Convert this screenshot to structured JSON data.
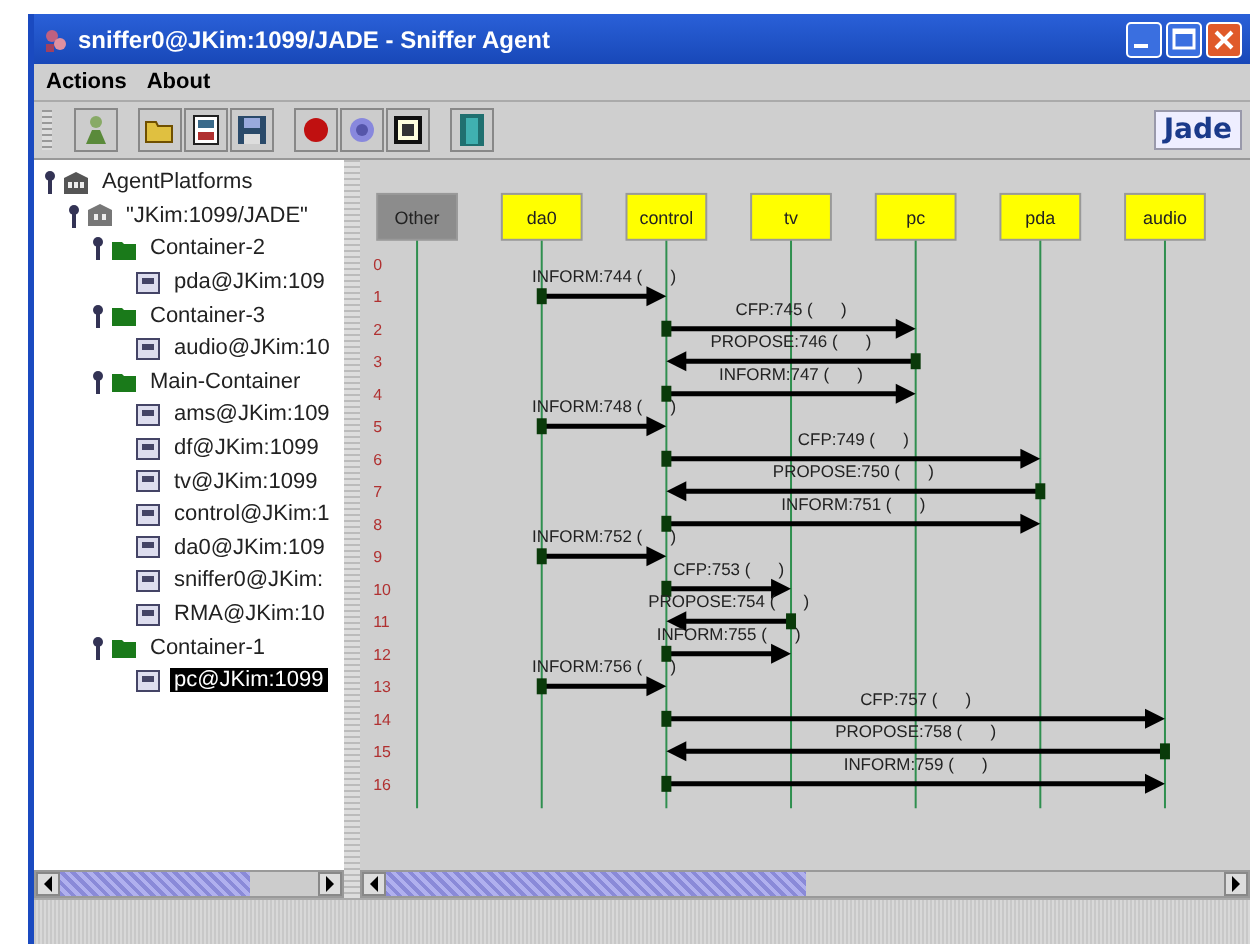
{
  "window": {
    "title": "sniffer0@JKim:1099/JADE - Sniffer Agent"
  },
  "menu": [
    {
      "label": "Actions"
    },
    {
      "label": "About"
    }
  ],
  "toolbar": {
    "logo": "Jade"
  },
  "tree": [
    {
      "label": "AgentPlatforms",
      "kind": "root",
      "expanded": true,
      "selected": false,
      "children": [
        {
          "label": "\"JKim:1099/JADE\"",
          "kind": "platform",
          "expanded": true,
          "selected": false,
          "children": [
            {
              "label": "Container-2",
              "kind": "container",
              "expanded": true,
              "selected": false,
              "children": [
                {
                  "label": "pda@JKim:109",
                  "kind": "agent",
                  "selected": false
                }
              ]
            },
            {
              "label": "Container-3",
              "kind": "container",
              "expanded": true,
              "selected": false,
              "children": [
                {
                  "label": "audio@JKim:10",
                  "kind": "agent",
                  "selected": false
                }
              ]
            },
            {
              "label": "Main-Container",
              "kind": "container",
              "expanded": true,
              "selected": false,
              "children": [
                {
                  "label": "ams@JKim:109",
                  "kind": "agent",
                  "selected": false
                },
                {
                  "label": "df@JKim:1099",
                  "kind": "agent",
                  "selected": false
                },
                {
                  "label": "tv@JKim:1099",
                  "kind": "agent",
                  "selected": false
                },
                {
                  "label": "control@JKim:1",
                  "kind": "agent",
                  "selected": false
                },
                {
                  "label": "da0@JKim:109",
                  "kind": "agent",
                  "selected": false
                },
                {
                  "label": "sniffer0@JKim:",
                  "kind": "agent",
                  "selected": false
                },
                {
                  "label": "RMA@JKim:10",
                  "kind": "agent",
                  "selected": false
                }
              ]
            },
            {
              "label": "Container-1",
              "kind": "container",
              "expanded": true,
              "selected": false,
              "children": [
                {
                  "label": "pc@JKim:1099",
                  "kind": "agent",
                  "selected": true
                }
              ]
            }
          ]
        }
      ]
    }
  ],
  "sniffer": {
    "agents": [
      {
        "name": "Other",
        "color": "#8c8c8c"
      },
      {
        "name": "da0",
        "color": "#ffff00"
      },
      {
        "name": "control",
        "color": "#ffff00"
      },
      {
        "name": "tv",
        "color": "#ffff00"
      },
      {
        "name": "pc",
        "color": "#ffff00"
      },
      {
        "name": "pda",
        "color": "#ffff00"
      },
      {
        "name": "audio",
        "color": "#ffff00"
      }
    ],
    "rows": [
      {
        "number": "0"
      },
      {
        "number": "1",
        "message": {
          "label": "INFORM:744 (      )",
          "ends": [
            {
              "kind": "none"
            },
            {
              "kind": "sender"
            },
            {
              "kind": "receiver"
            }
          ]
        }
      },
      {
        "number": "2",
        "message": {
          "label": "CFP:745 (      )",
          "ends": [
            {
              "kind": "none"
            },
            {
              "kind": "none"
            },
            {
              "kind": "sender"
            },
            {
              "kind": "none"
            },
            {
              "kind": "receiver"
            }
          ]
        }
      },
      {
        "number": "3",
        "message": {
          "label": "PROPOSE:746 (      )",
          "ends": [
            {
              "kind": "none"
            },
            {
              "kind": "none"
            },
            {
              "kind": "receiver"
            },
            {
              "kind": "none"
            },
            {
              "kind": "sender"
            }
          ]
        }
      },
      {
        "number": "4",
        "message": {
          "label": "INFORM:747 (      )",
          "ends": [
            {
              "kind": "none"
            },
            {
              "kind": "none"
            },
            {
              "kind": "sender"
            },
            {
              "kind": "none"
            },
            {
              "kind": "receiver"
            }
          ]
        }
      },
      {
        "number": "5",
        "message": {
          "label": "INFORM:748 (      )",
          "ends": [
            {
              "kind": "none"
            },
            {
              "kind": "sender"
            },
            {
              "kind": "receiver"
            }
          ]
        }
      },
      {
        "number": "6",
        "message": {
          "label": "CFP:749 (      )",
          "ends": [
            {
              "kind": "none"
            },
            {
              "kind": "none"
            },
            {
              "kind": "sender"
            },
            {
              "kind": "none"
            },
            {
              "kind": "none"
            },
            {
              "kind": "receiver"
            }
          ]
        }
      },
      {
        "number": "7",
        "message": {
          "label": "PROPOSE:750 (      )",
          "ends": [
            {
              "kind": "none"
            },
            {
              "kind": "none"
            },
            {
              "kind": "receiver"
            },
            {
              "kind": "none"
            },
            {
              "kind": "none"
            },
            {
              "kind": "sender"
            }
          ]
        }
      },
      {
        "number": "8",
        "message": {
          "label": "INFORM:751 (      )",
          "ends": [
            {
              "kind": "none"
            },
            {
              "kind": "none"
            },
            {
              "kind": "sender"
            },
            {
              "kind": "none"
            },
            {
              "kind": "none"
            },
            {
              "kind": "receiver"
            }
          ]
        }
      },
      {
        "number": "9",
        "message": {
          "label": "INFORM:752 (      )",
          "ends": [
            {
              "kind": "none"
            },
            {
              "kind": "sender"
            },
            {
              "kind": "receiver"
            }
          ]
        }
      },
      {
        "number": "10",
        "message": {
          "label": "CFP:753 (      )",
          "ends": [
            {
              "kind": "none"
            },
            {
              "kind": "none"
            },
            {
              "kind": "sender"
            },
            {
              "kind": "receiver"
            }
          ]
        }
      },
      {
        "number": "11",
        "message": {
          "label": "PROPOSE:754 (      )",
          "ends": [
            {
              "kind": "none"
            },
            {
              "kind": "none"
            },
            {
              "kind": "receiver"
            },
            {
              "kind": "sender"
            }
          ]
        }
      },
      {
        "number": "12",
        "message": {
          "label": "INFORM:755 (      )",
          "ends": [
            {
              "kind": "none"
            },
            {
              "kind": "none"
            },
            {
              "kind": "sender"
            },
            {
              "kind": "receiver"
            }
          ]
        }
      },
      {
        "number": "13",
        "message": {
          "label": "INFORM:756 (      )",
          "ends": [
            {
              "kind": "none"
            },
            {
              "kind": "sender"
            },
            {
              "kind": "receiver"
            }
          ]
        }
      },
      {
        "number": "14",
        "message": {
          "label": "CFP:757 (      )",
          "ends": [
            {
              "kind": "none"
            },
            {
              "kind": "none"
            },
            {
              "kind": "sender"
            },
            {
              "kind": "none"
            },
            {
              "kind": "none"
            },
            {
              "kind": "none"
            },
            {
              "kind": "receiver"
            }
          ]
        }
      },
      {
        "number": "15",
        "message": {
          "label": "PROPOSE:758 (      )",
          "ends": [
            {
              "kind": "none"
            },
            {
              "kind": "none"
            },
            {
              "kind": "receiver"
            },
            {
              "kind": "none"
            },
            {
              "kind": "none"
            },
            {
              "kind": "none"
            },
            {
              "kind": "sender"
            }
          ]
        }
      },
      {
        "number": "16",
        "message": {
          "label": "INFORM:759 (      )",
          "ends": [
            {
              "kind": "none"
            },
            {
              "kind": "none"
            },
            {
              "kind": "sender"
            },
            {
              "kind": "none"
            },
            {
              "kind": "none"
            },
            {
              "kind": "none"
            },
            {
              "kind": "receiver"
            }
          ]
        }
      }
    ]
  }
}
